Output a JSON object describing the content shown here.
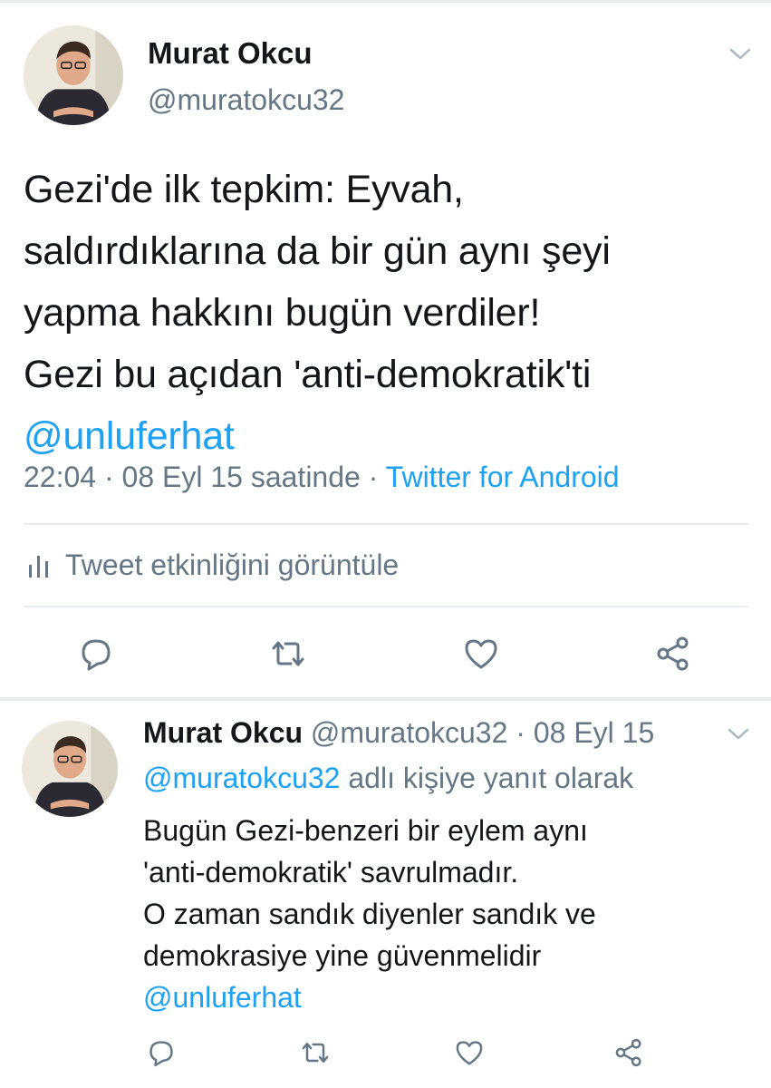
{
  "main_tweet": {
    "display_name": "Murat Okcu",
    "username": "@muratokcu32",
    "text_lines": [
      "Gezi'de ilk tepkim: Eyvah,",
      "saldırdıklarına da bir gün aynı şeyi",
      "yapma hakkını bugün verdiler!",
      "Gezi bu açıdan 'anti-demokratik'ti"
    ],
    "mention": "@unluferhat",
    "timestamp": "22:04 · 08 Eyl 15 saatinde · ",
    "source": "Twitter for Android",
    "activity_label": "Tweet etkinliğini görüntüle",
    "icons": [
      "bar-chart-icon",
      "reply-icon",
      "retweet-icon",
      "like-icon",
      "share-icon",
      "chevron-down-icon"
    ]
  },
  "reply_tweet": {
    "display_name": "Murat Okcu",
    "username_date": " @muratokcu32 · 08 Eyl 15",
    "reply_to_mention": "@muratokcu32",
    "reply_to_suffix": " adlı kişiye yanıt olarak",
    "text_lines": [
      "Bugün Gezi-benzeri bir eylem aynı",
      "'anti-demokratik' savrulmadır.",
      "O zaman sandık diyenler sandık ve",
      "demokrasiye yine güvenmelidir"
    ],
    "mention": "@unluferhat"
  },
  "colors": {
    "accent": "#1da1f2",
    "secondary_text": "#657786",
    "primary_text": "#14171a",
    "divider": "#e6ecf0"
  }
}
